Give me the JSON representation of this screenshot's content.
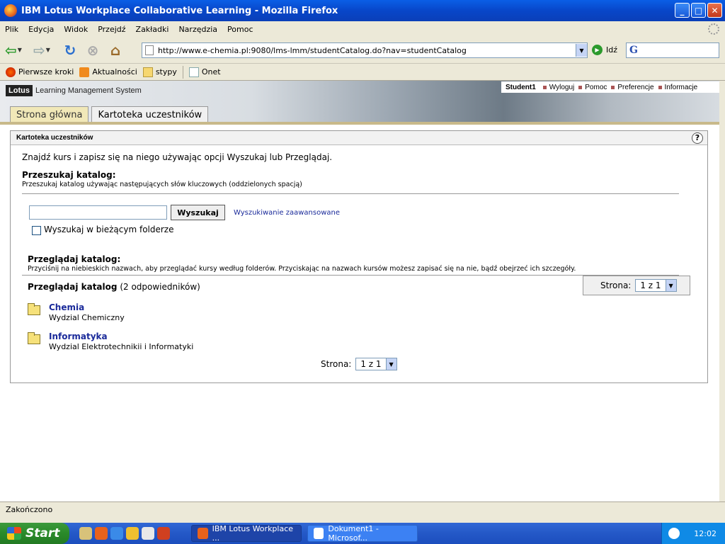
{
  "window": {
    "title": "IBM Lotus Workplace Collaborative Learning - Mozilla Firefox"
  },
  "menu": [
    "Plik",
    "Edycja",
    "Widok",
    "Przejdź",
    "Zakładki",
    "Narzędzia",
    "Pomoc"
  ],
  "nav": {
    "url": "http://www.e-chemia.pl:9080/lms-lmm/studentCatalog.do?nav=studentCatalog",
    "go_label": "Idź",
    "search_engine_letter": "G"
  },
  "bookmarks": [
    "Pierwsze kroki",
    "Aktualności",
    "stypy",
    "Onet"
  ],
  "banner": {
    "brand": "Lotus",
    "title": "Learning Management System",
    "user": "Student1",
    "links": [
      "Wyloguj",
      "Pomoc",
      "Preferencje",
      "Informacje"
    ]
  },
  "tabs": [
    {
      "label": "Strona główna",
      "active": false
    },
    {
      "label": "Kartoteka uczestników",
      "active": true
    }
  ],
  "panel": {
    "title": "Kartoteka uczestników",
    "help": "?",
    "intro": "Znajdź kurs i zapisz się na niego używając opcji Wyszukaj lub Przeglądaj.",
    "search_title": "Przeszukaj katalog:",
    "search_desc": "Przeszukaj katalog używając następujących słów kluczowych (oddzielonych spacją)",
    "search_value": "",
    "search_button": "Wyszukaj",
    "advanced_link": "Wyszukiwanie zaawansowane",
    "checkbox_label": "Wyszukaj w bieżącym folderze",
    "browse_title": "Przeglądaj katalog:",
    "browse_desc": "Przyciśnij na niebieskich nazwach, aby przeglądać kursy według folderów. Przyciskając na nazwach kursów możesz zapisać się na nie, bądź obejrzeć ich szczegóły.",
    "browse_label": "Przeglądaj katalog",
    "browse_count": "(2  odpowiedników)",
    "pager_label": "Strona:",
    "pager_value": "1 z 1",
    "folders": [
      {
        "name": "Chemia",
        "desc": "Wydzial Chemiczny"
      },
      {
        "name": "Informatyka",
        "desc": "Wydzial Elektrotechnikii i Informatyki"
      }
    ]
  },
  "status": "Zakończono",
  "taskbar": {
    "start": "Start",
    "tasks": [
      "IBM Lotus Workplace ...",
      "Dokument1 - Microsof..."
    ],
    "clock": "12:02"
  }
}
